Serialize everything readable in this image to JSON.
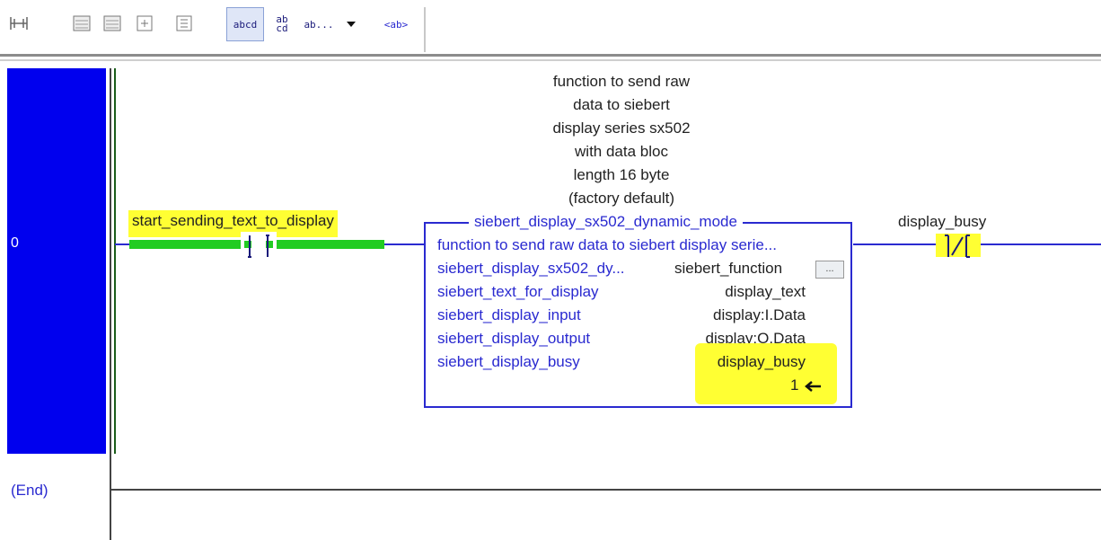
{
  "toolbar": {
    "icons": [
      "branch-icon",
      "rung-icon",
      "rung-edit-icon",
      "insert-icon",
      "append-icon"
    ],
    "text_view_label": "abcd",
    "wrap_label": "ab cd",
    "truncate_label": "ab...",
    "tag_label": "<ab>"
  },
  "rung0": {
    "number": "0",
    "comment": [
      "function to send raw",
      "data to siebert",
      "display series sx502",
      "with data bloc",
      "length 16 byte",
      "(factory default)"
    ],
    "xic_tag": "start_sending_text_to_display",
    "aoi": {
      "name": "siebert_display_sx502_dynamic_mode",
      "description": "function to send raw data to siebert display serie...",
      "rows": [
        {
          "param": "siebert_display_sx502_dy...",
          "value": "siebert_function"
        },
        {
          "param": "siebert_text_for_display",
          "value": "display_text"
        },
        {
          "param": "siebert_display_input",
          "value": "display:I.Data"
        },
        {
          "param": "siebert_display_output",
          "value": "display:O.Data"
        },
        {
          "param": "siebert_display_busy",
          "value": "display_busy"
        }
      ],
      "busy_value": "1",
      "ellipsis_button": "..."
    },
    "xio_tag": "display_busy"
  },
  "end_label": "(End)",
  "colors": {
    "rung_margin": "#0000ee",
    "highlight": "#ffff33",
    "energized": "#22cc22",
    "wire": "#2a2ad0"
  }
}
